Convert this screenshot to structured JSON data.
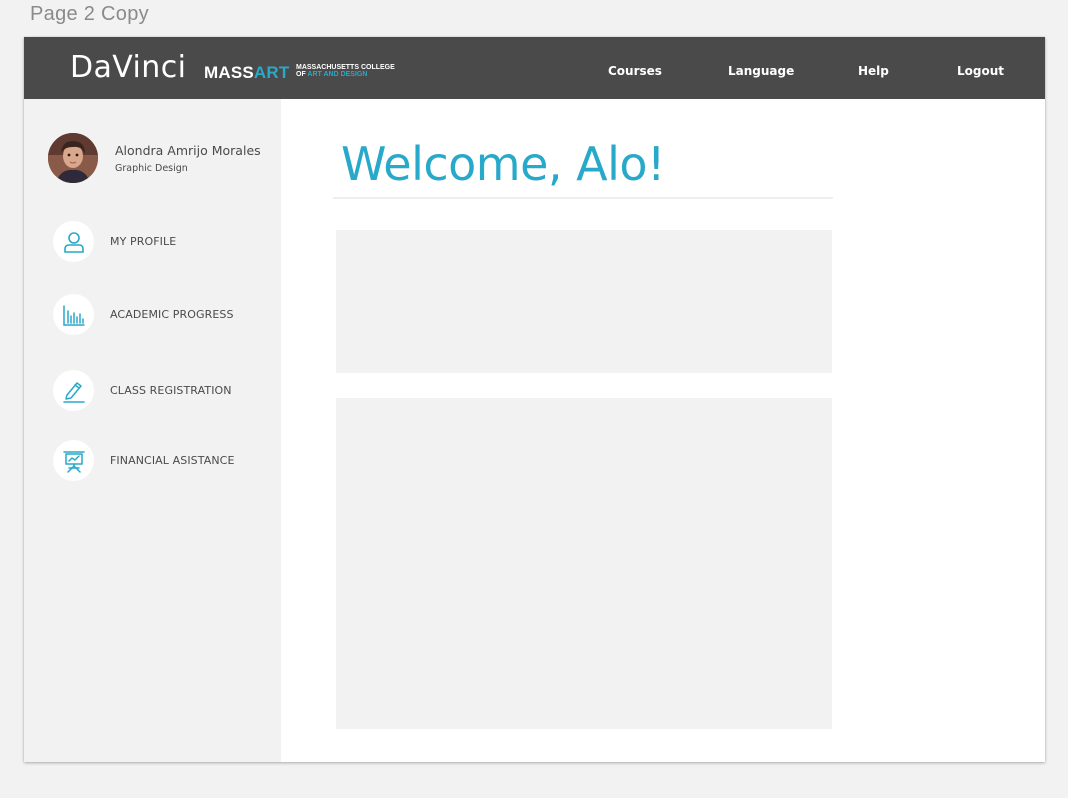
{
  "artboard": {
    "label": "Page 2 Copy"
  },
  "header": {
    "brand": "DaVinci",
    "logo": {
      "mass": "MASS",
      "art": "ART",
      "sub_line1": "MASSACHUSETTS COLLEGE",
      "sub_line2_prefix": "OF ",
      "sub_line2_highlight": "ART AND DESIGN"
    },
    "nav": {
      "courses": "Courses",
      "language": "Language",
      "help": "Help",
      "logout": "Logout"
    },
    "background_color": "#4a4a4a"
  },
  "sidebar": {
    "user": {
      "name": "Alondra Amrijo Morales",
      "program": "Graphic Design"
    },
    "items": [
      {
        "label": "MY PROFILE",
        "icon": "user-icon"
      },
      {
        "label": "ACADEMIC PROGRESS",
        "icon": "bar-chart-icon"
      },
      {
        "label": "CLASS REGISTRATION",
        "icon": "pencil-icon"
      },
      {
        "label": "FINANCIAL ASISTANCE",
        "icon": "presentation-board-icon"
      }
    ],
    "background_color": "#f2f2f2"
  },
  "main": {
    "welcome": "Welcome, Alo!",
    "accent_color": "#28a9c9"
  }
}
